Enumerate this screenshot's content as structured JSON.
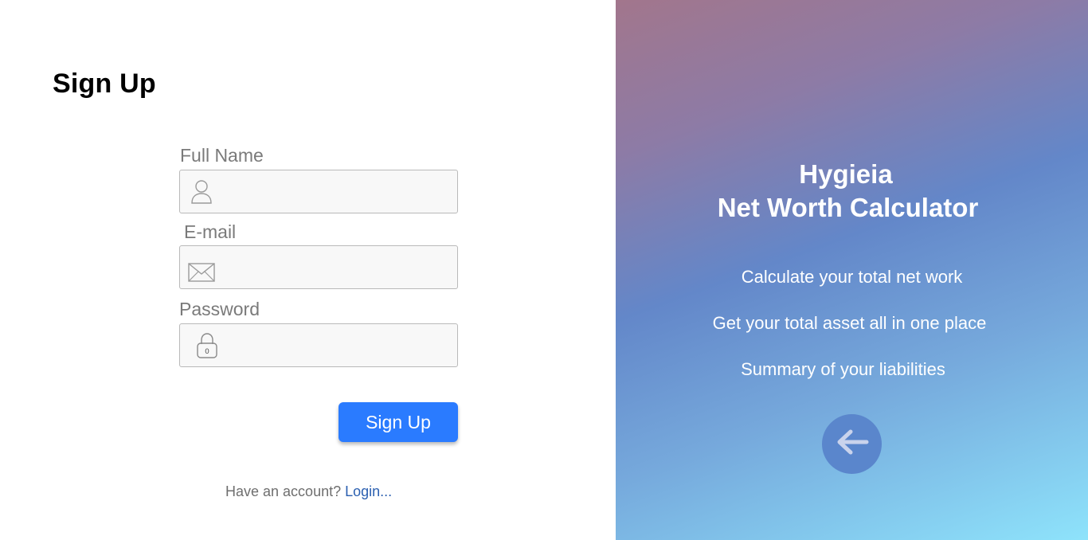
{
  "signup": {
    "title": "Sign Up",
    "fields": {
      "full_name": {
        "label": "Full Name",
        "value": "",
        "placeholder": "",
        "icon": "user-icon"
      },
      "email": {
        "label": "E-mail",
        "value": "",
        "placeholder": "",
        "icon": "envelope-icon"
      },
      "password": {
        "label": "Password",
        "value": "",
        "placeholder": "",
        "icon": "lock-icon"
      }
    },
    "submit_label": "Sign Up",
    "account_prompt": "Have an account?",
    "login_link": "Login..."
  },
  "promo": {
    "title_line1": "Hygieia",
    "title_line2": "Net Worth Calculator",
    "features": [
      "Calculate your total net work",
      "Get your total asset all in one place",
      "Summary of your liabilities"
    ],
    "back_icon": "arrow-left-icon"
  },
  "colors": {
    "accent": "#2a7bff",
    "link": "#2a5fb0",
    "back_button": "#5a86cc",
    "gradient_top": "#a2768c",
    "gradient_bottom": "#8ee3fb"
  }
}
